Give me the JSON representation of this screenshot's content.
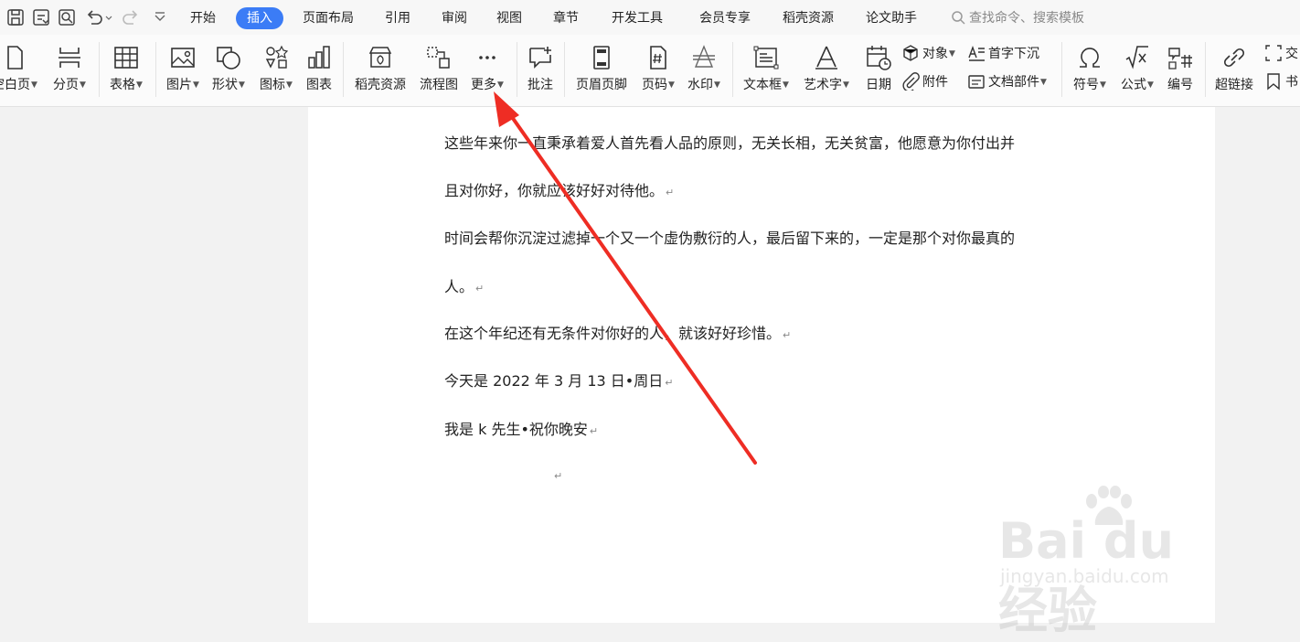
{
  "menubar": {
    "tabs": [
      "开始",
      "插入",
      "页面布局",
      "引用",
      "审阅",
      "视图",
      "章节",
      "开发工具",
      "会员专享",
      "稻壳资源",
      "论文助手"
    ],
    "active_tab": "插入",
    "search_placeholder": "查找命令、搜索模板"
  },
  "ribbon": {
    "blank_page": "空白页",
    "page_break": "分页",
    "table": "表格",
    "picture": "图片",
    "shape": "形状",
    "icon": "图标",
    "chart": "图表",
    "docer_resource": "稻壳资源",
    "flowchart": "流程图",
    "more": "更多",
    "comment": "批注",
    "header_footer": "页眉页脚",
    "page_number": "页码",
    "watermark": "水印",
    "text_box": "文本框",
    "word_art": "艺术字",
    "date": "日期",
    "object": "对象",
    "attachment": "附件",
    "drop_cap": "首字下沉",
    "doc_parts": "文档部件",
    "symbol": "符号",
    "equation": "公式",
    "numbering": "编号",
    "hyperlink": "超链接",
    "cross_ref_partial": "交",
    "bookmark_partial": "书"
  },
  "document": {
    "lines": [
      "这些年来你一直秉承着爱人首先看人品的原则，无关长相，无关贫富，他愿意为你付出并",
      "且对你好，你就应该好好对待他。",
      "时间会帮你沉淀过滤掉一个又一个虚伪敷衍的人，最后留下来的，一定是那个对你最真的",
      "人。",
      "在这个年纪还有无条件对你好的人，就该好好珍惜。",
      "今天是 2022 年 3 月 13 日•周日",
      "我是 k 先生•祝你晚安"
    ],
    "paragraph_mark": "↵"
  },
  "watermark": {
    "logo": "Bai du 经验",
    "url": "jingyan.baidu.com"
  },
  "colors": {
    "active_tab": "#3b7cf6",
    "annotation_arrow": "#ee2d24"
  }
}
